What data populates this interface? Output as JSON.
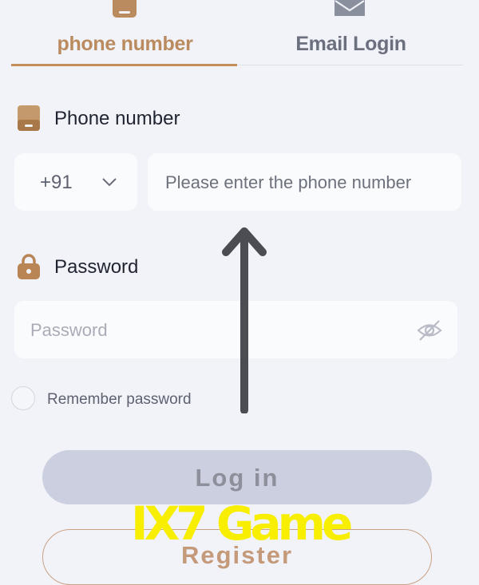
{
  "tabs": {
    "phone": {
      "label": "phone number",
      "icon": "phone-icon",
      "active": true
    },
    "email": {
      "label": "Email Login",
      "icon": "mail-icon",
      "active": false
    }
  },
  "phone_field": {
    "label": "Phone number",
    "label_icon": "phone-icon",
    "country_code": "+91",
    "country_code_icon": "chevron-down-icon",
    "placeholder": "Please enter the phone number"
  },
  "password_field": {
    "label": "Password",
    "label_icon": "lock-icon",
    "placeholder": "Password",
    "toggle_icon": "eye-off-icon"
  },
  "remember": {
    "label": "Remember password",
    "checked": false
  },
  "buttons": {
    "login": "Log in",
    "register": "Register"
  },
  "overlay": {
    "arrow_icon": "arrow-up-icon",
    "watermark": "IX7 Game"
  },
  "colors": {
    "accent": "#c28f5d",
    "background": "#f2f3f9",
    "field_background": "#fafbfd",
    "login_disabled": "#cbcfdf",
    "arrow": "#4b4d52",
    "watermark": "#f7ee00"
  }
}
